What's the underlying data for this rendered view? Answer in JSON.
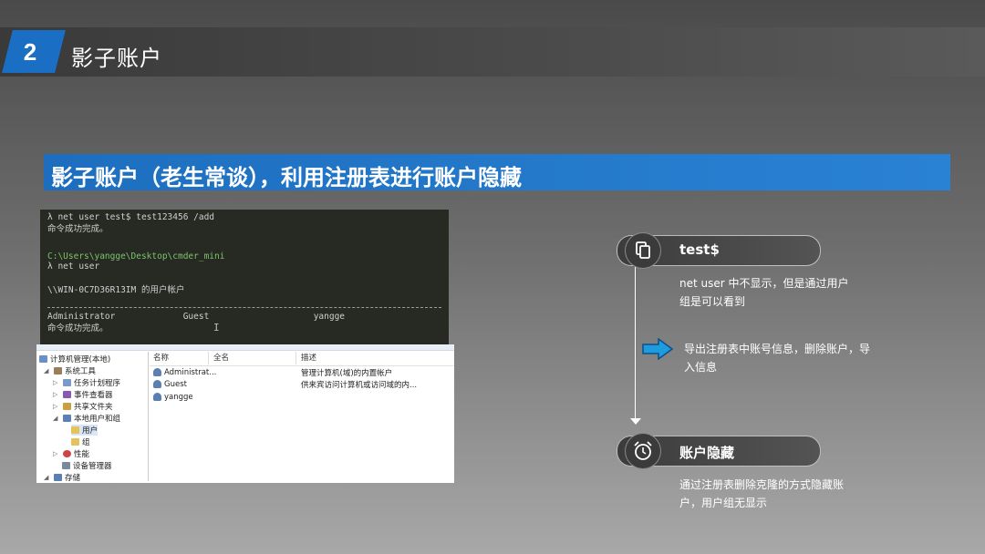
{
  "slide": {
    "number": "2",
    "section_title": "影子账户",
    "headline": "影子账户（老生常谈），利用注册表进行账户隐藏"
  },
  "terminal": {
    "lines": [
      "λ net user test$ test123456 /add",
      "命令成功完成。",
      "C:\\Users\\yangge\\Desktop\\cmder_mini",
      "λ net user",
      "\\\\WIN-0C7D36R13IM 的用户帐户",
      "Administrator             Guest                    yangge",
      "命令成功完成。"
    ],
    "cursor": "I"
  },
  "mmc": {
    "tree": [
      "计算机管理(本地)",
      "系统工具",
      "任务计划程序",
      "事件查看器",
      "共享文件夹",
      "本地用户和组",
      "用户",
      "组",
      "性能",
      "设备管理器",
      "存储"
    ],
    "columns": [
      "名称",
      "全名",
      "描述"
    ],
    "rows": [
      {
        "name": "Administrat...",
        "fullname": "",
        "desc": "管理计算机(域)的内置帐户"
      },
      {
        "name": "Guest",
        "fullname": "",
        "desc": "供来宾访问计算机或访问域的内..."
      },
      {
        "name": "yangge",
        "fullname": "",
        "desc": ""
      }
    ]
  },
  "flow": {
    "step1_label": "test$",
    "step1_desc_line1": "net user 中不显示，但是通过用户",
    "step1_desc_line2": "组是可以看到",
    "middle_desc_line1": "导出注册表中账号信息，删除账户，导",
    "middle_desc_line2": "入信息",
    "step2_label": "账户隐藏",
    "step2_desc_line1": "通过注册表删除克隆的方式隐藏账",
    "step2_desc_line2": "户，用户组无显示"
  },
  "icons": {
    "step1": "clipboard-copy-icon",
    "middle": "right-arrow-icon",
    "step2": "alarm-clock-icon"
  },
  "colors": {
    "accent_blue": "#1d6ebf",
    "arrow_blue": "#1e9ce0"
  }
}
